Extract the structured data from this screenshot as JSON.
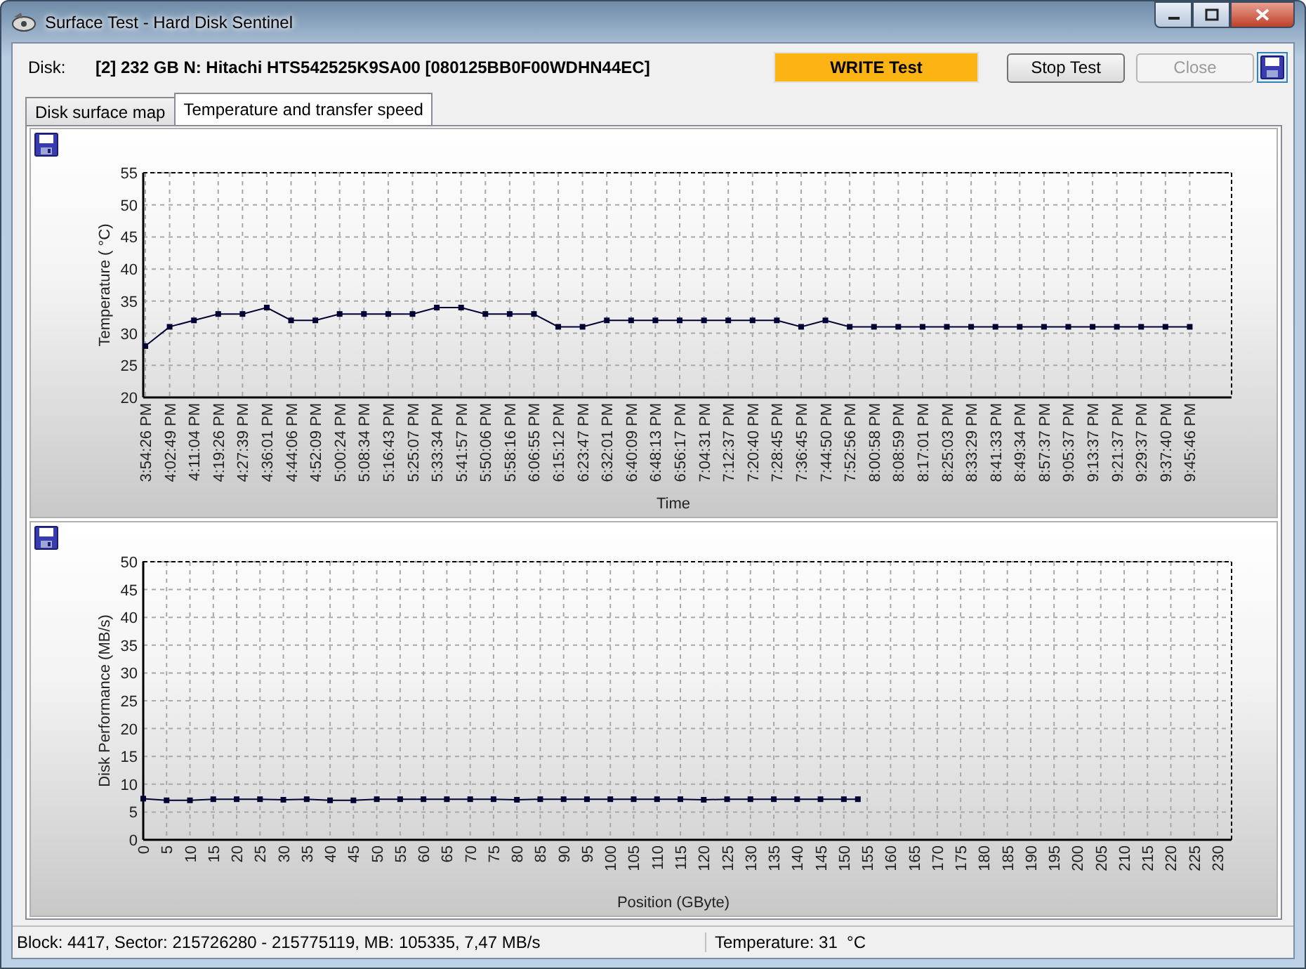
{
  "window": {
    "title": "Surface Test - Hard Disk Sentinel"
  },
  "header": {
    "disk_label": "Disk:",
    "disk_name": "[2] 232 GB N: Hitachi HTS542525K9SA00 [080125BB0F00WDHN44EC]",
    "test_mode": "WRITE Test",
    "buttons": [
      {
        "label": "Stop Test",
        "disabled": false
      },
      {
        "label": "Close",
        "disabled": true
      }
    ]
  },
  "tabs": [
    {
      "label": "Disk surface map",
      "selected": false
    },
    {
      "label": "Temperature and transfer speed",
      "selected": true
    }
  ],
  "charts": [
    {
      "chart_data": {
        "type": "line",
        "grid": true,
        "xlabel": "Time",
        "ylabel": "Temperature ( °C)",
        "ylim": [
          20,
          55
        ],
        "yticks": [
          20,
          25,
          30,
          35,
          40,
          45,
          50,
          55
        ],
        "categories": [
          "3:54:26 PM",
          "4:02:49 PM",
          "4:11:04 PM",
          "4:19:26 PM",
          "4:27:39 PM",
          "4:36:01 PM",
          "4:44:06 PM",
          "4:52:09 PM",
          "5:00:24 PM",
          "5:08:34 PM",
          "5:16:43 PM",
          "5:25:07 PM",
          "5:33:34 PM",
          "5:41:57 PM",
          "5:50:06 PM",
          "5:58:16 PM",
          "6:06:55 PM",
          "6:15:12 PM",
          "6:23:47 PM",
          "6:32:01 PM",
          "6:40:09 PM",
          "6:48:13 PM",
          "6:56:17 PM",
          "7:04:31 PM",
          "7:12:37 PM",
          "7:20:40 PM",
          "7:28:45 PM",
          "7:36:45 PM",
          "7:44:50 PM",
          "7:52:56 PM",
          "8:00:58 PM",
          "8:08:59 PM",
          "8:17:01 PM",
          "8:25:03 PM",
          "8:33:29 PM",
          "8:41:33 PM",
          "8:49:34 PM",
          "8:57:37 PM",
          "9:05:37 PM",
          "9:13:37 PM",
          "9:21:37 PM",
          "9:29:37 PM",
          "9:37:40 PM",
          "9:45:46 PM"
        ],
        "series": [
          {
            "color": "#000033",
            "marker": "square",
            "values": [
              28,
              31,
              32,
              33,
              33,
              34,
              32,
              32,
              33,
              33,
              33,
              33,
              34,
              34,
              33,
              33,
              33,
              31,
              31,
              32,
              32,
              32,
              32,
              32,
              32,
              32,
              32,
              31,
              32,
              31,
              31,
              31,
              31,
              31,
              31,
              31,
              31,
              31,
              31,
              31,
              31,
              31,
              31,
              31
            ]
          }
        ]
      }
    },
    {
      "chart_data": {
        "type": "line",
        "grid": true,
        "xlabel": "Position (GByte)",
        "ylabel": "Disk Performance (MB/s)",
        "xlim": [
          0,
          230
        ],
        "ylim": [
          0,
          50
        ],
        "yticks": [
          0,
          5,
          10,
          15,
          20,
          25,
          30,
          35,
          40,
          45,
          50
        ],
        "xticks": [
          0,
          5,
          10,
          15,
          20,
          25,
          30,
          35,
          40,
          45,
          50,
          55,
          60,
          65,
          70,
          75,
          80,
          85,
          90,
          95,
          100,
          105,
          110,
          115,
          120,
          125,
          130,
          135,
          140,
          145,
          150,
          155,
          160,
          165,
          170,
          175,
          180,
          185,
          190,
          195,
          200,
          205,
          210,
          215,
          220,
          225,
          230
        ],
        "x": [
          0,
          5,
          10,
          15,
          20,
          25,
          30,
          35,
          40,
          45,
          50,
          55,
          60,
          65,
          70,
          75,
          80,
          85,
          90,
          95,
          100,
          105,
          110,
          115,
          120,
          125,
          130,
          135,
          140,
          145,
          150,
          153
        ],
        "series": [
          {
            "color": "#000033",
            "marker": "square",
            "values": [
              7.4,
              7.1,
              7.1,
              7.3,
              7.3,
              7.3,
              7.2,
              7.3,
              7.1,
              7.1,
              7.3,
              7.3,
              7.3,
              7.3,
              7.3,
              7.3,
              7.2,
              7.3,
              7.3,
              7.3,
              7.3,
              7.3,
              7.3,
              7.3,
              7.2,
              7.3,
              7.3,
              7.3,
              7.3,
              7.3,
              7.3,
              7.3
            ]
          }
        ]
      }
    }
  ],
  "status_bar": {
    "position": "Block: 4417, Sector: 215726280 - 215775119, MB: 105335, 7,47 MB/s",
    "temperature": "Temperature: 31  °C"
  }
}
